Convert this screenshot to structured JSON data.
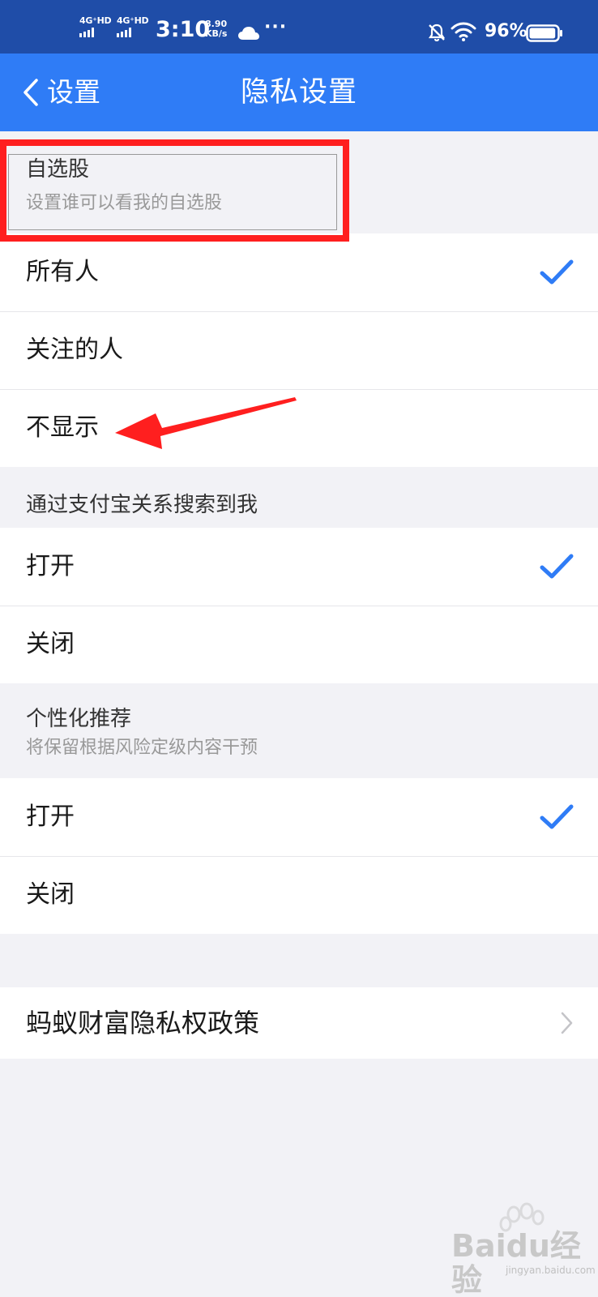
{
  "status_bar": {
    "network1": "4G⁺HD",
    "network2": "4G⁺HD",
    "time": "3:10",
    "speed_value": "8.90",
    "speed_unit": "KB/s",
    "more": "···",
    "battery_pct": "96%",
    "battery_level": 0.96
  },
  "nav": {
    "back_label": "设置",
    "title": "隐私设置"
  },
  "sections": {
    "watchlist": {
      "title": "自选股",
      "subtitle": "设置谁可以看我的自选股",
      "options": [
        {
          "label": "所有人",
          "checked": true
        },
        {
          "label": "关注的人",
          "checked": false
        },
        {
          "label": "不显示",
          "checked": false
        }
      ]
    },
    "alipay_search": {
      "title": "通过支付宝关系搜索到我",
      "options": [
        {
          "label": "打开",
          "checked": true
        },
        {
          "label": "关闭",
          "checked": false
        }
      ]
    },
    "personalized": {
      "title": "个性化推荐",
      "subtitle": "将保留根据风险定级内容干预",
      "options": [
        {
          "label": "打开",
          "checked": true
        },
        {
          "label": "关闭",
          "checked": false
        }
      ]
    },
    "policy": {
      "label": "蚂蚁财富隐私权政策"
    }
  },
  "colors": {
    "status_bar": "#1f4da8",
    "nav_bar": "#2f7cf6",
    "check": "#2f7cf6",
    "annotation": "#ff1f1f"
  },
  "watermark": {
    "text": "Baidu经验",
    "sub": "jingyan.baidu.com"
  }
}
